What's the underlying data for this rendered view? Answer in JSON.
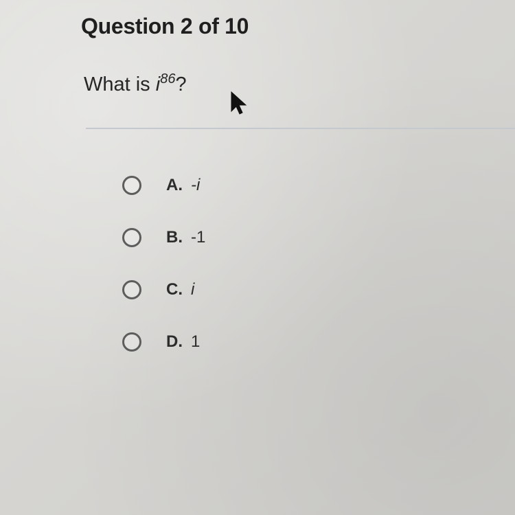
{
  "header": {
    "title": "Question 2 of 10"
  },
  "question": {
    "prefix": "What is ",
    "base": "i",
    "exponent": "86",
    "suffix": "?"
  },
  "options": [
    {
      "letter": "A.",
      "value": "-i",
      "italic": true
    },
    {
      "letter": "B.",
      "value": "-1",
      "italic": false
    },
    {
      "letter": "C.",
      "value": "i",
      "italic": true
    },
    {
      "letter": "D.",
      "value": "1",
      "italic": false
    }
  ],
  "icons": {
    "cursor": "mouse-pointer-icon",
    "radio": "radio-button-icon"
  }
}
